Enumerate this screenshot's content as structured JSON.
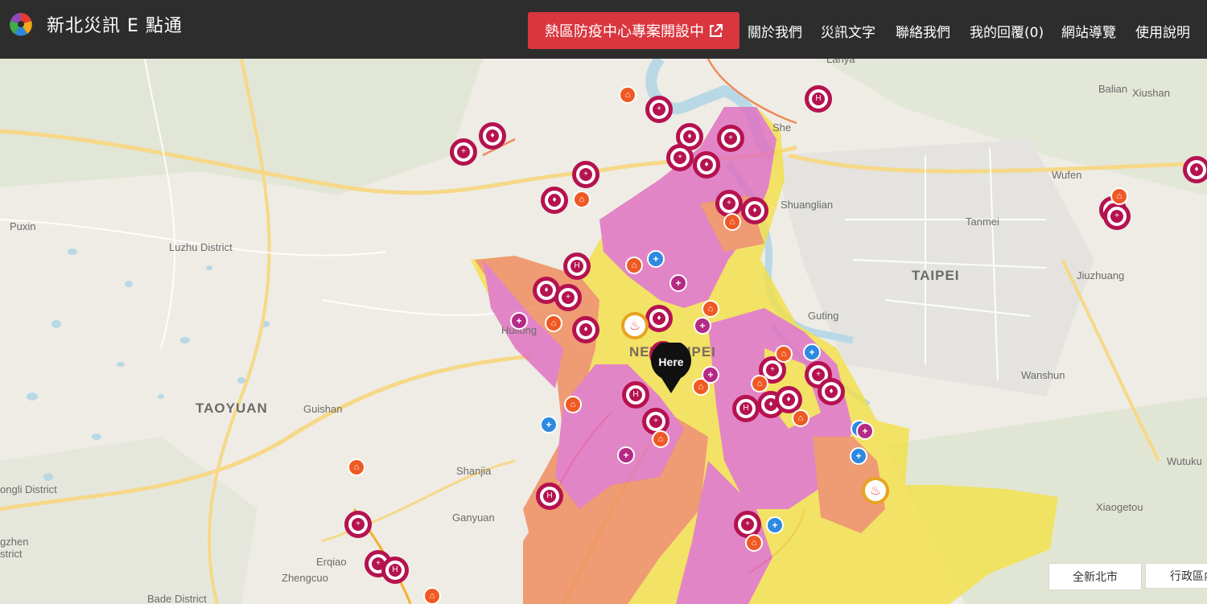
{
  "header": {
    "title": "新北災訊 E 點通",
    "promo_button": "熱區防疫中心專案開設中",
    "nav": [
      "關於我們",
      "災訊文字",
      "聯絡我們",
      "我的回覆(0)",
      "網站導覽",
      "使用說明"
    ]
  },
  "map": {
    "labels": {
      "puxin": "Puxin",
      "luzhu": "Luzhu District",
      "taoyuan": "TAOYUAN",
      "guishan": "Guishan",
      "zhongli": "ongli District",
      "zhen_a": "gzhen",
      "zhen_b": "strict",
      "huilong": "Huilong",
      "new_taipei": "NEW TAIPEI",
      "shanjia": "Shanjia",
      "ganyuan": "Ganyuan",
      "erqiao": "Erqiao",
      "zhengcuo": "Zhengcuo",
      "bade": "Bade District",
      "shuanglian": "Shuanglian",
      "taipei": "TAIPEI",
      "tanmei": "Tanmei",
      "wufen": "Wufen",
      "jiuzhuang": "Jiuzhuang",
      "guting": "Guting",
      "wanshun": "Wanshun",
      "wutuku": "Wutuku",
      "xiaogetou": "Xiaogetou",
      "balian": "Balian",
      "xiushan": "Xiushan",
      "lanya": "Lanya",
      "sheng": "She"
    },
    "here_label": "Here",
    "controls": [
      "全新北市",
      "行政區內"
    ]
  },
  "colors": {
    "topbar": "#2d2d2d",
    "promo": "#d9363e",
    "marker_crimson": "#b5124f",
    "shelter_orange": "#ef5a24",
    "medical_blue": "#2d8ae0",
    "medical_purple": "#b52a84",
    "fire_ring": "#e9a320",
    "zone_yellow": "#f3e04a",
    "zone_orange": "#f08a5c",
    "zone_pink": "#e06fc0"
  },
  "icons": {
    "shelter": "house-icon",
    "medical": "medical-cross-icon",
    "fire": "fire-icon",
    "crimson": "person-icon",
    "pin": "location-pin-icon",
    "external": "external-link-icon"
  }
}
